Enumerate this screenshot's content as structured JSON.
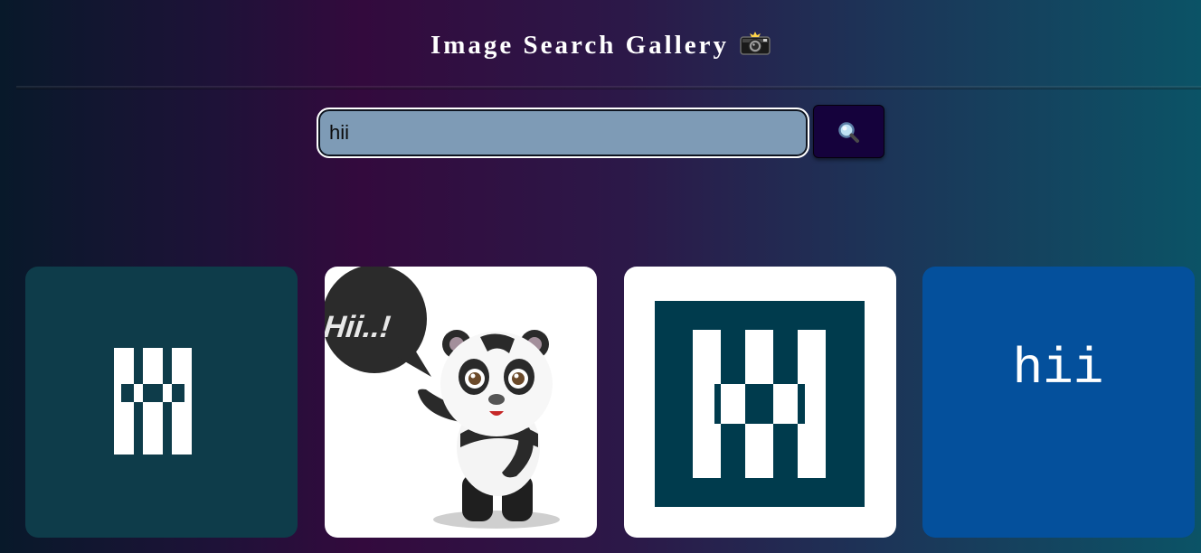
{
  "header": {
    "title": "Image Search Gallery",
    "title_icon": "camera-flash-icon"
  },
  "search": {
    "value": "hii",
    "button_icon": "search-icon"
  },
  "gallery": {
    "items": [
      {
        "icon": "hii-logo-image",
        "bg": "#0e3c4a"
      },
      {
        "icon": "panda-hii-image",
        "bubble_text": "Hii..!"
      },
      {
        "icon": "hii-logo-framed-image",
        "bg": "#003b4d"
      },
      {
        "icon": "hii-text-image",
        "text": "hii",
        "bg": "#04509c"
      }
    ]
  },
  "colors": {
    "accent_button": "#15023c",
    "input_bg": "#7e9bb6"
  }
}
